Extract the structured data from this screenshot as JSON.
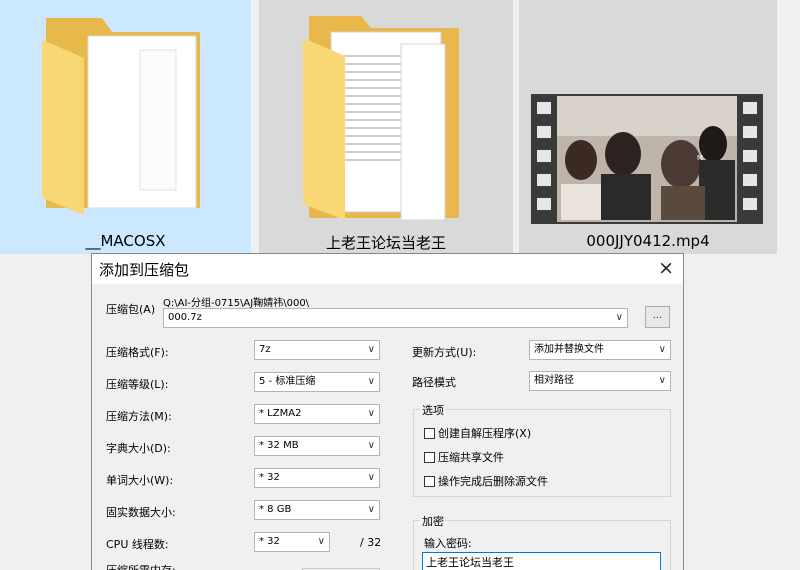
{
  "files": [
    {
      "name": "__MACOSX",
      "icon": "folder-icon",
      "selected": true
    },
    {
      "name": "上老王论坛当老王",
      "icon": "folder-with-documents-icon",
      "selected": false
    },
    {
      "name": "000JJY0412.mp4",
      "icon": "video-thumbnail-icon",
      "selected": false
    }
  ],
  "dialog": {
    "title": "添加到压缩包",
    "close_glyph": "×",
    "archive": {
      "label": "压缩包(A)",
      "path": "Q:\\AI-分组-0715\\AJ鞠婧祎\\000\\",
      "value": "000.7z",
      "browse_label": "..."
    },
    "left_fields": [
      {
        "label": "压缩格式(F):",
        "value": "7z"
      },
      {
        "label": "压缩等级(L):",
        "value": "5 - 标准压缩"
      },
      {
        "label": "压缩方法(M):",
        "value": "* LZMA2"
      },
      {
        "label": "字典大小(D):",
        "value": "* 32 MB"
      },
      {
        "label": "单词大小(W):",
        "value": "* 32"
      },
      {
        "label": "固实数据大小:",
        "value": "* 8 GB"
      }
    ],
    "threads": {
      "label": "CPU 线程数:",
      "value": "* 32",
      "total": "/ 32"
    },
    "memory": {
      "label": "压缩所需内存:"
    },
    "update": {
      "label": "更新方式(U):",
      "value": "添加并替换文件"
    },
    "path_mode": {
      "label": "路径模式",
      "value": "相对路径"
    },
    "options": {
      "title": "选项",
      "items": [
        {
          "label": "创建自解压程序(X)",
          "checked": false
        },
        {
          "label": "压缩共享文件",
          "checked": false
        },
        {
          "label": "操作完成后删除源文件",
          "checked": false
        }
      ]
    },
    "encryption": {
      "title": "加密",
      "password_label": "输入密码:",
      "password_value": "上老王论坛当老王"
    }
  },
  "colors": {
    "selected_tile": "#cce8ff",
    "tile": "#d9d9d9",
    "folder": "#f8d775",
    "focus": "#0078d7"
  }
}
